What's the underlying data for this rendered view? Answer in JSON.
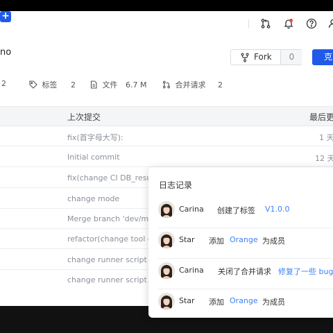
{
  "header": {
    "icons": [
      "plus-icon",
      "pull-request-icon",
      "bell-icon",
      "help-icon",
      "user-icon"
    ],
    "notify_color": "#e8463c"
  },
  "repo": {
    "name_fragment": "no"
  },
  "fork": {
    "label": "Fork",
    "count": "0"
  },
  "primary_button": {
    "label": "克"
  },
  "stats": [
    {
      "icon": "",
      "label": "",
      "value": "2"
    },
    {
      "icon": "tag-icon",
      "label": "标签",
      "value": "2"
    },
    {
      "icon": "file-icon",
      "label": "文件",
      "value": "6.7 M"
    },
    {
      "icon": "merge-request-icon",
      "label": "合并请求",
      "value": "2"
    }
  ],
  "table": {
    "headers": {
      "commit": "上次提交",
      "updated": "最后更"
    },
    "rows": [
      {
        "message": "fix(首字母大写):",
        "time": "1 天"
      },
      {
        "message": "Initial commit",
        "time": "12 天"
      },
      {
        "message": "fix(change CI DB_resul",
        "time": ""
      },
      {
        "message": "change mode",
        "time": ""
      },
      {
        "message": "Merge branch 'dev/ma",
        "time": ""
      },
      {
        "message": "refactor(change tool ch",
        "time": ""
      },
      {
        "message": "change runner script",
        "time": ""
      },
      {
        "message": "change runner script",
        "time": ""
      }
    ]
  },
  "activity": {
    "title": "日志记录",
    "entries": [
      {
        "user": "Carina",
        "action": "创建了标签",
        "target": "V1.0.0",
        "suffix": ""
      },
      {
        "user": "Star",
        "action": "添加",
        "target": "Orange",
        "suffix": "为成员"
      },
      {
        "user": "Carina",
        "action": "关闭了合并请求",
        "target": "修复了一些 bug",
        "suffix": ""
      },
      {
        "user": "Star",
        "action": "添加",
        "target": "Orange",
        "suffix": "为成员"
      }
    ],
    "link_color": "#3b82f6"
  },
  "colors": {
    "primary": "#1f5be8",
    "header_bg": "#f4f5f7"
  }
}
